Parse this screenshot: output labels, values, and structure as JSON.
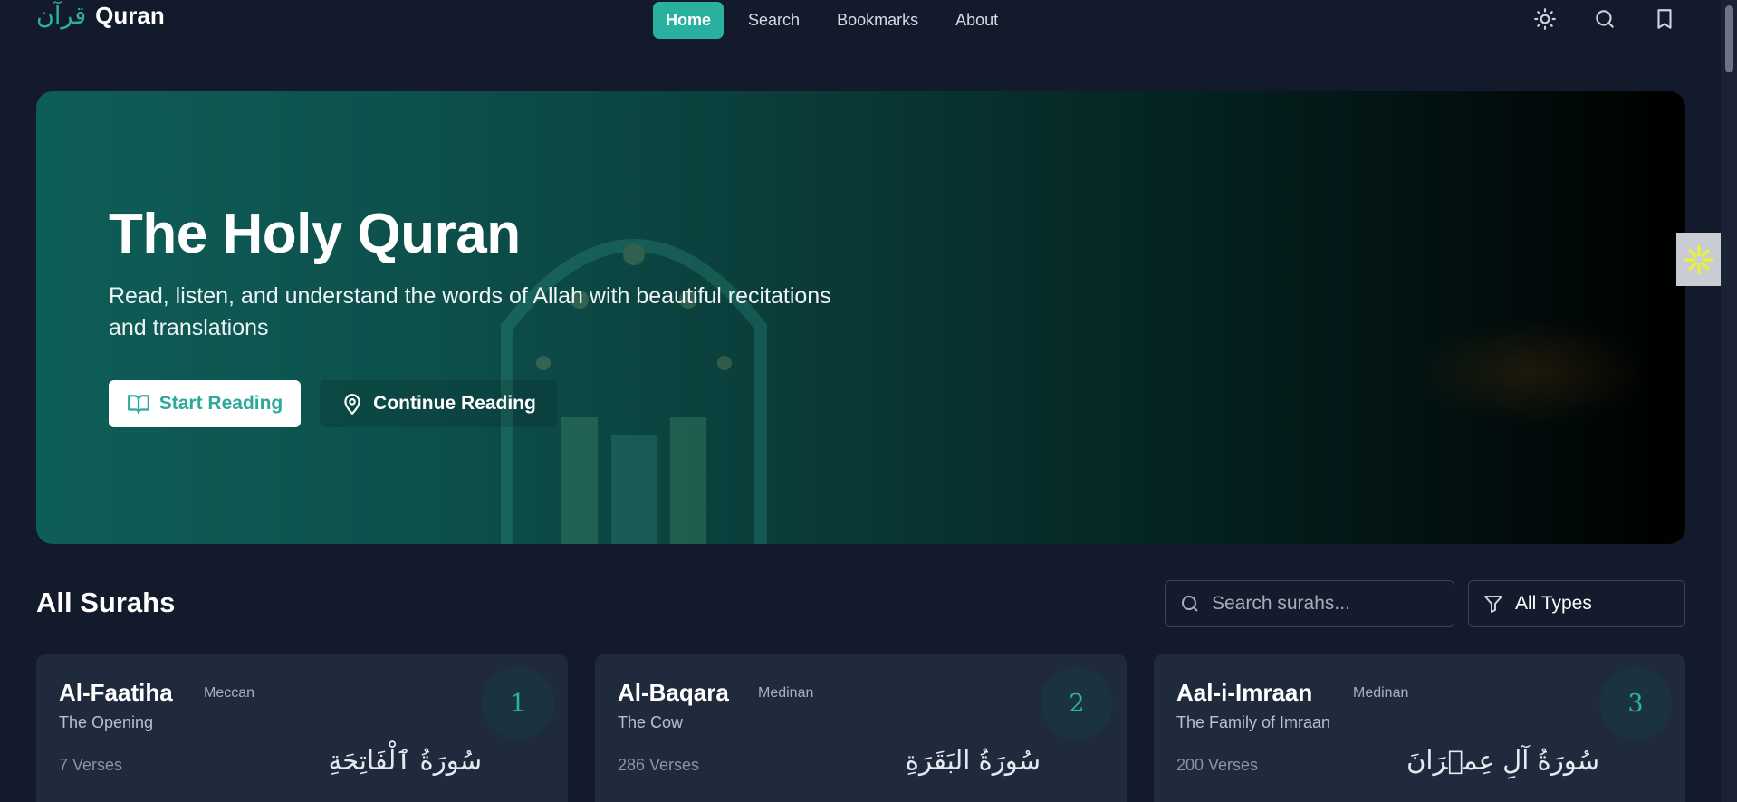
{
  "nav": {
    "brand_ar": "قرآن",
    "brand_en": "Quran",
    "links": [
      {
        "label": "Home",
        "active": true
      },
      {
        "label": "Search",
        "active": false
      },
      {
        "label": "Bookmarks",
        "active": false
      },
      {
        "label": "About",
        "active": false
      }
    ],
    "icons": [
      "sun-icon",
      "search-icon",
      "bookmark-icon"
    ]
  },
  "hero": {
    "title": "The Holy Quran",
    "subtitle": "Read, listen, and understand the words of Allah with beautiful recitations and translations",
    "start_label": "Start Reading",
    "continue_label": "Continue Reading"
  },
  "surahs": {
    "title": "All Surahs",
    "search_placeholder": "Search surahs...",
    "type_filter": "All Types",
    "cards": [
      {
        "number": "1",
        "name": "Al-Faatiha",
        "type": "Meccan",
        "english": "The Opening",
        "verses": "7 Verses",
        "arabic": "سُورَةُ ٱلْفَاتِحَةِ"
      },
      {
        "number": "2",
        "name": "Al-Baqara",
        "type": "Medinan",
        "english": "The Cow",
        "verses": "286 Verses",
        "arabic": "سُورَةُ البَقَرَةِ"
      },
      {
        "number": "3",
        "name": "Aal-i-Imraan",
        "type": "Medinan",
        "english": "The Family of Imraan",
        "verses": "200 Verses",
        "arabic": "سُورَةُ آلِ عِمۡرَانَ"
      }
    ]
  },
  "colors": {
    "accent": "#2ab09e",
    "background": "#121a2b",
    "card": "#1f2a3c"
  }
}
